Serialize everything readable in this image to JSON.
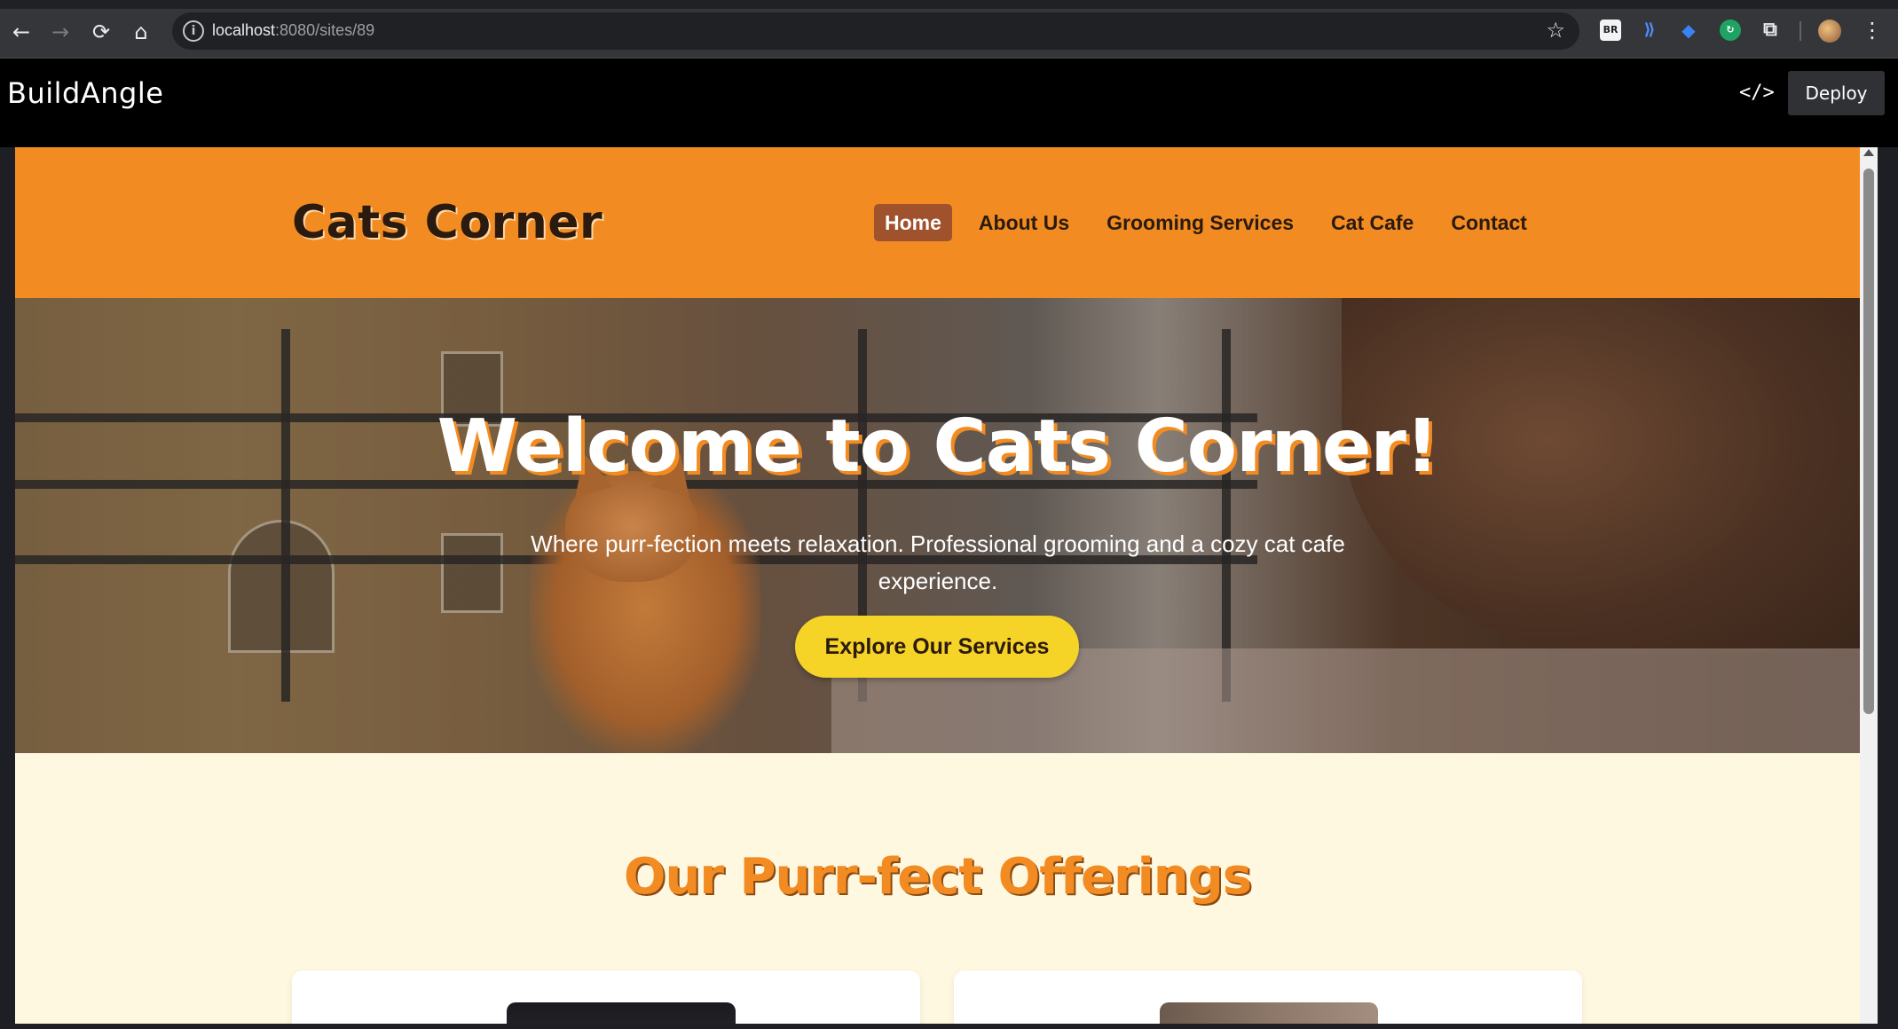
{
  "browser": {
    "url_host": "localhost",
    "url_path": ":8080/sites/89",
    "ext_br_label": "BR"
  },
  "app": {
    "logo": "BuildAngle",
    "code_toggle": "</>",
    "deploy_label": "Deploy"
  },
  "site": {
    "title": "Cats Corner",
    "nav": [
      {
        "label": "Home",
        "active": true
      },
      {
        "label": "About Us"
      },
      {
        "label": "Grooming Services"
      },
      {
        "label": "Cat Cafe"
      },
      {
        "label": "Contact"
      }
    ],
    "hero": {
      "title": "Welcome to Cats Corner!",
      "subtitle": "Where purr-fection meets relaxation. Professional grooming and a cozy cat cafe experience.",
      "cta": "Explore Our Services"
    },
    "offerings": {
      "title": "Our Purr-fect Offerings"
    }
  },
  "colors": {
    "header_orange": "#f28c22",
    "nav_active": "#a0522d",
    "cta_yellow": "#f5d327",
    "section_bg": "#fff8e1",
    "title_dark": "#2b1a0e"
  }
}
